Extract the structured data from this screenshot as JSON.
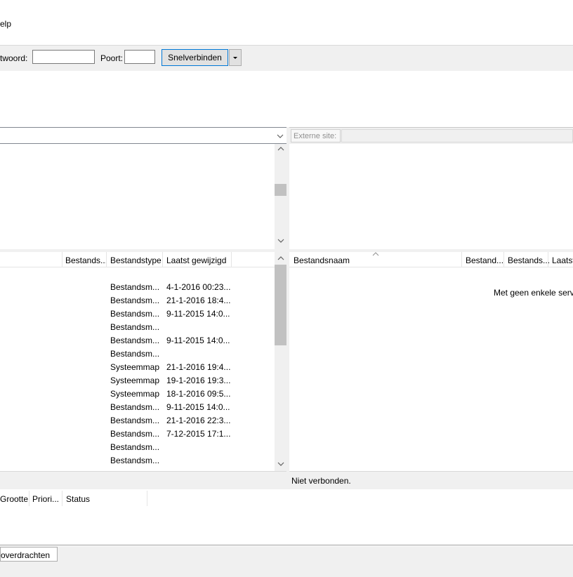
{
  "menubar": {
    "help_label": "elp"
  },
  "quickconnect": {
    "password_label": "twoord:",
    "password_value": "",
    "port_label": "Poort:",
    "port_value": "",
    "connect_button": "Snelverbinden",
    "dropdown_icon": "dropdown-arrow-icon"
  },
  "remote_site": {
    "label": "Externe site:"
  },
  "local_list": {
    "columns": [
      "Bestands...",
      "Bestandstype",
      "Laatst gewijzigd"
    ],
    "rows": [
      {
        "type": "Bestandsm...",
        "modified": "4-1-2016 00:23..."
      },
      {
        "type": "Bestandsm...",
        "modified": "21-1-2016 18:4..."
      },
      {
        "type": "Bestandsm...",
        "modified": "9-11-2015 14:0..."
      },
      {
        "type": "Bestandsm...",
        "modified": ""
      },
      {
        "type": "Bestandsm...",
        "modified": "9-11-2015 14:0..."
      },
      {
        "type": "Bestandsm...",
        "modified": ""
      },
      {
        "type": "Systeemmap",
        "modified": "21-1-2016 19:4..."
      },
      {
        "type": "Systeemmap",
        "modified": "19-1-2016 19:3..."
      },
      {
        "type": "Systeemmap",
        "modified": "18-1-2016 09:5..."
      },
      {
        "type": "Bestandsm...",
        "modified": "9-11-2015 14:0..."
      },
      {
        "type": "Bestandsm...",
        "modified": "21-1-2016 22:3..."
      },
      {
        "type": "Bestandsm...",
        "modified": "7-12-2015 17:1..."
      },
      {
        "type": "Bestandsm...",
        "modified": ""
      },
      {
        "type": "Bestandsm...",
        "modified": ""
      }
    ]
  },
  "remote_list": {
    "columns": [
      "Bestandsnaam",
      "Bestand...",
      "Bestands...",
      "Laatst"
    ],
    "empty_message": "Met geen enkele serve",
    "status": "Niet verbonden."
  },
  "queue": {
    "columns": [
      "Grootte",
      "Priori...",
      "Status"
    ],
    "tab_label": "overdrachten"
  }
}
